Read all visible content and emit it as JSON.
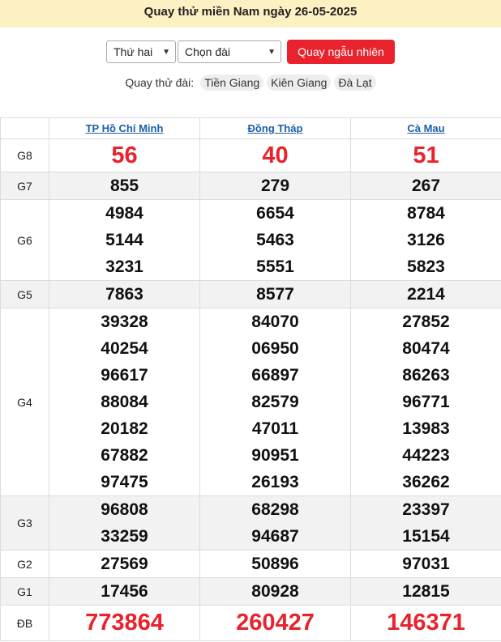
{
  "header": {
    "title": "Quay thử miền Nam ngày 26-05-2025"
  },
  "controls": {
    "day_select": "Thứ hai",
    "station_select": "Chọn đài",
    "random_button": "Quay ngẫu nhiên"
  },
  "quick": {
    "label": "Quay thử đài:",
    "stations": [
      "Tiền Giang",
      "Kiên Giang",
      "Đà Lạt"
    ]
  },
  "table": {
    "stations": [
      "TP Hồ Chí Minh",
      "Đồng Tháp",
      "Cà Mau"
    ],
    "prizes": [
      {
        "name": "G8",
        "results": [
          [
            "56"
          ],
          [
            "40"
          ],
          [
            "51"
          ]
        ]
      },
      {
        "name": "G7",
        "results": [
          [
            "855"
          ],
          [
            "279"
          ],
          [
            "267"
          ]
        ]
      },
      {
        "name": "G6",
        "results": [
          [
            "4984",
            "5144",
            "3231"
          ],
          [
            "6654",
            "5463",
            "5551"
          ],
          [
            "8784",
            "3126",
            "5823"
          ]
        ]
      },
      {
        "name": "G5",
        "results": [
          [
            "7863"
          ],
          [
            "8577"
          ],
          [
            "2214"
          ]
        ]
      },
      {
        "name": "G4",
        "results": [
          [
            "39328",
            "40254",
            "96617",
            "88084",
            "20182",
            "67882",
            "97475"
          ],
          [
            "84070",
            "06950",
            "66897",
            "82579",
            "47011",
            "90951",
            "26193"
          ],
          [
            "27852",
            "80474",
            "86263",
            "96771",
            "13983",
            "44223",
            "36262"
          ]
        ]
      },
      {
        "name": "G3",
        "results": [
          [
            "96808",
            "33259"
          ],
          [
            "68298",
            "94687"
          ],
          [
            "23397",
            "15154"
          ]
        ]
      },
      {
        "name": "G2",
        "results": [
          [
            "27569"
          ],
          [
            "50896"
          ],
          [
            "97031"
          ]
        ]
      },
      {
        "name": "G1",
        "results": [
          [
            "17456"
          ],
          [
            "80928"
          ],
          [
            "12815"
          ]
        ]
      },
      {
        "name": "ĐB",
        "results": [
          [
            "773864"
          ],
          [
            "260427"
          ],
          [
            "146371"
          ]
        ]
      }
    ]
  },
  "colors": {
    "accent_red": "#e8232d",
    "banner_bg": "#fdf1c4",
    "link_blue": "#1a5fa8"
  }
}
